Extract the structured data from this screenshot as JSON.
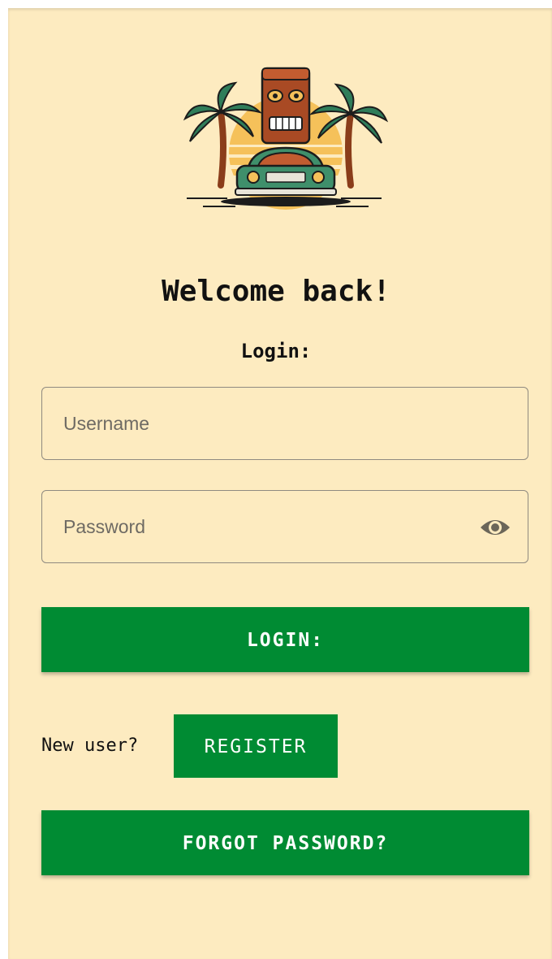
{
  "header": {
    "logo_icon": "tiki-car-palm-logo",
    "title": "Welcome back!",
    "subtitle": "Login:"
  },
  "form": {
    "username_placeholder": "Username",
    "username_value": "",
    "password_placeholder": "Password",
    "password_value": "",
    "password_toggle_icon": "eye-icon",
    "login_label": "LOGIN:"
  },
  "register": {
    "prompt": "New user?",
    "button_label": "REGISTER"
  },
  "forgot": {
    "button_label": "FORGOT PASSWORD?"
  },
  "colors": {
    "background": "#fdebc0",
    "accent_green": "#008b33",
    "button_text": "#ffffff"
  }
}
